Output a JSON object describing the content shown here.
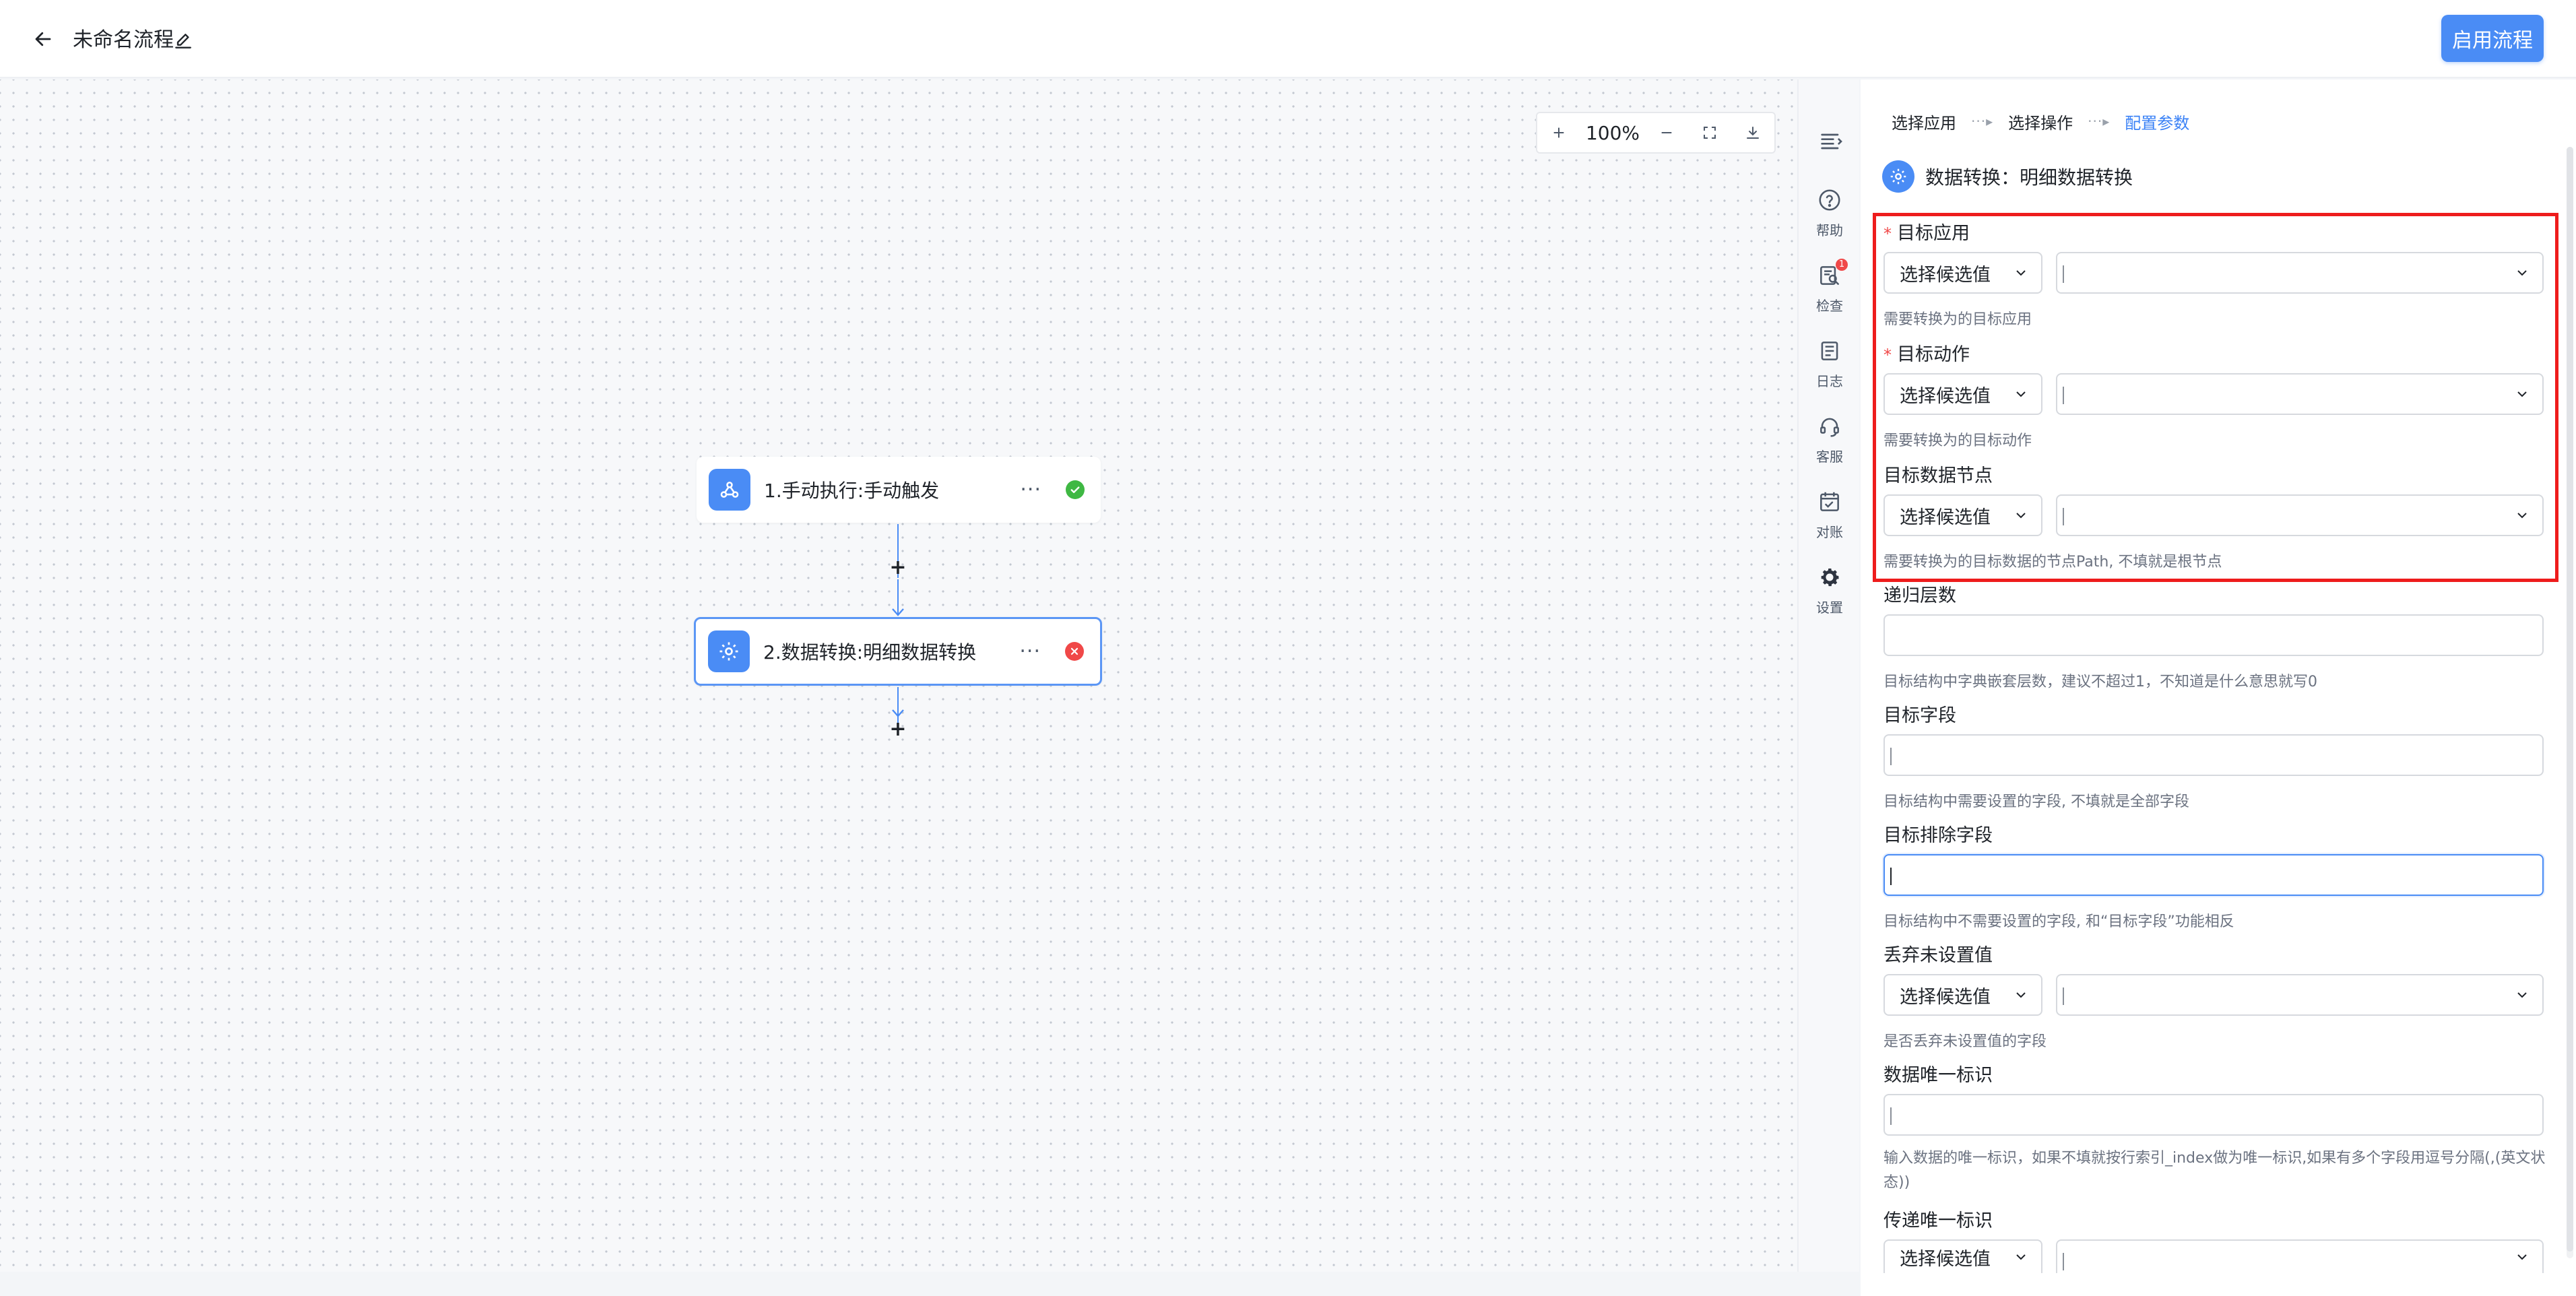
{
  "header": {
    "title": "未命名流程",
    "enable_label": "启用流程"
  },
  "canvas": {
    "zoom_label": "100%",
    "nodes": [
      {
        "label": "1.手动执行:手动触发",
        "status": "success"
      },
      {
        "label": "2.数据转换:明细数据转换",
        "status": "error"
      }
    ],
    "more_label": "···",
    "add_label": "+"
  },
  "rail": {
    "items": [
      {
        "label": "帮助",
        "icon": "help-icon"
      },
      {
        "label": "检查",
        "icon": "check-icon",
        "badge": "1"
      },
      {
        "label": "日志",
        "icon": "log-icon"
      },
      {
        "label": "客服",
        "icon": "support-icon"
      },
      {
        "label": "对账",
        "icon": "reconcile-icon"
      },
      {
        "label": "设置",
        "icon": "gear-icon"
      }
    ]
  },
  "panel": {
    "steps": [
      "选择应用",
      "选择操作",
      "配置参数"
    ],
    "step_sep": "···▸",
    "title": "数据转换：明细数据转换",
    "required_mark": "*",
    "select_placeholder": "选择候选值",
    "fields": {
      "target_app": {
        "label": "目标应用",
        "hint": "需要转换为的目标应用"
      },
      "target_action": {
        "label": "目标动作",
        "hint": "需要转换为的目标动作"
      },
      "target_node": {
        "label": "目标数据节点",
        "hint": "需要转换为的目标数据的节点Path, 不填就是根节点"
      },
      "recursion": {
        "label": "递归层数",
        "hint": "目标结构中字典嵌套层数，建议不超过1，不知道是什么意思就写0"
      },
      "target_fields": {
        "label": "目标字段",
        "hint": "目标结构中需要设置的字段, 不填就是全部字段"
      },
      "exclude_fields": {
        "label": "目标排除字段",
        "hint": "目标结构中不需要设置的字段, 和“目标字段”功能相反"
      },
      "drop_unset": {
        "label": "丢弃未设置值",
        "hint": "是否丢弃未设置值的字段"
      },
      "unique_id": {
        "label": "数据唯一标识",
        "hint": "输入数据的唯一标识，如果不填就按行索引_index做为唯一标识,如果有多个字段用逗号分隔(,(英文状态))"
      },
      "pass_unique": {
        "label": "传递唯一标识"
      }
    }
  },
  "colors": {
    "accent": "#4a8cf5",
    "success": "#3fb843",
    "error": "#f04848",
    "highlight": "#ee1c1c"
  }
}
